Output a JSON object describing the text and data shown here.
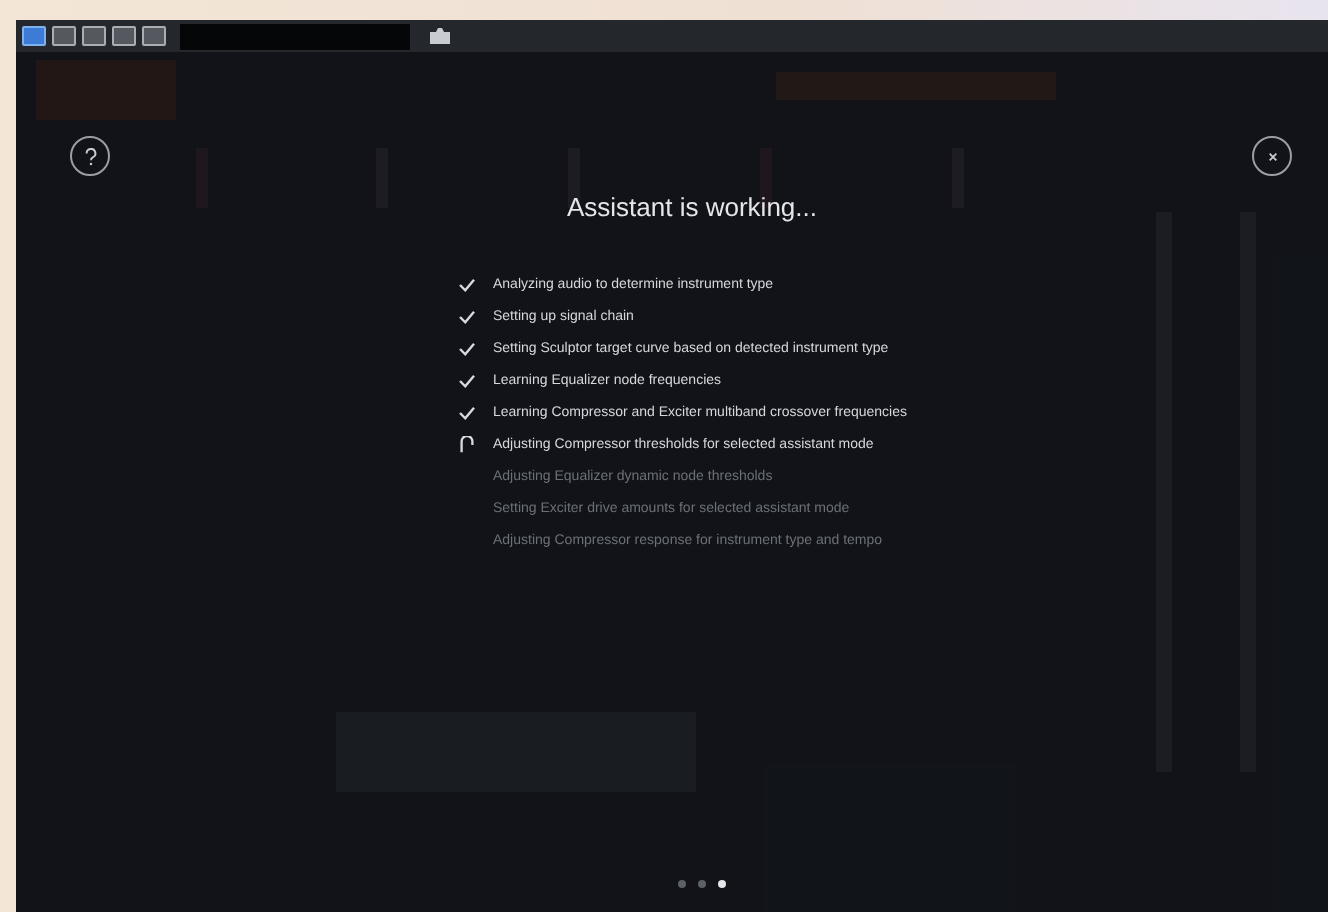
{
  "toolbar": {
    "buttons": [
      {
        "selected": true
      },
      {
        "selected": false
      },
      {
        "selected": false
      },
      {
        "selected": false
      },
      {
        "selected": false
      }
    ]
  },
  "title": "Assistant is working...",
  "steps": [
    {
      "text": "Analyzing audio to determine instrument type",
      "kind": "done"
    },
    {
      "text": "Setting up signal chain",
      "kind": "done"
    },
    {
      "text": "Setting Sculptor target curve based on detected instrument type",
      "kind": "done"
    },
    {
      "text": "Learning Equalizer node frequencies",
      "kind": "done"
    },
    {
      "text": "Learning Compressor and Exciter multiband crossover frequencies",
      "kind": "done"
    },
    {
      "text": "Adjusting Compressor thresholds for selected assistant mode",
      "kind": "active"
    },
    {
      "text": "Adjusting Equalizer dynamic node thresholds",
      "kind": "pending"
    },
    {
      "text": "Setting Exciter drive amounts for selected assistant mode",
      "kind": "pending"
    },
    {
      "text": "Adjusting Compressor response for instrument type and tempo",
      "kind": "pending"
    }
  ],
  "pager": [
    {
      "selected": false
    },
    {
      "selected": false
    },
    {
      "selected": true
    }
  ]
}
